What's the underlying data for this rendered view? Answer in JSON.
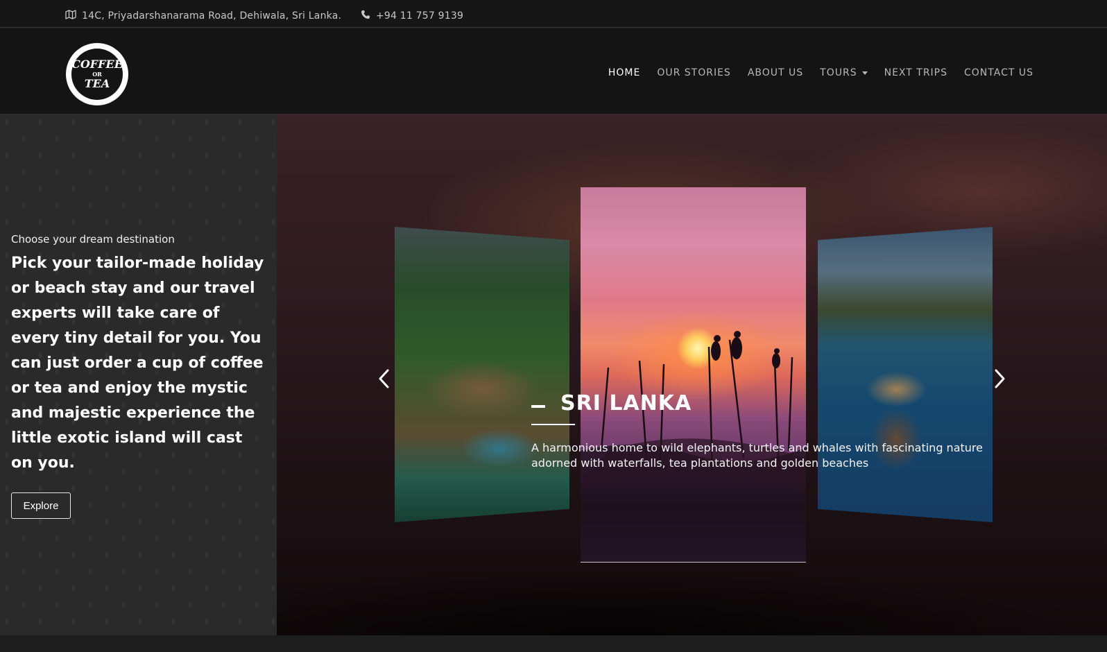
{
  "topbar": {
    "address": "14C, Priyadarshanarama Road, Dehiwala, Sri Lanka.",
    "address_icon": "map-icon",
    "phone": "+94 11 757 9139",
    "phone_icon": "phone-icon"
  },
  "logo": {
    "line1": "COFFEE",
    "line2": "OR",
    "line3": "TEA"
  },
  "nav": {
    "items": [
      {
        "label": "HOME",
        "active": true
      },
      {
        "label": "OUR STORIES"
      },
      {
        "label": "ABOUT US"
      },
      {
        "label": "TOURS",
        "has_dropdown": true
      },
      {
        "label": "NEXT TRIPS"
      },
      {
        "label": "CONTACT US"
      }
    ]
  },
  "intro": {
    "kicker": "Choose your dream destination",
    "headline": "Pick your tailor-made holiday or beach stay and our travel experts will take care of every tiny detail for you. You can just order a cup of coffee or tea and enjoy the mystic and majestic experience the little exotic island will cast on you.",
    "button_label": "Explore"
  },
  "carousel": {
    "slide_title": "SRI LANKA",
    "slide_description": "A harmonious home to wild elephants, turtles and whales with fascinating nature adorned with waterfalls, tea plantations and golden beaches",
    "prev_icon": "chevron-left-icon",
    "next_icon": "chevron-right-icon"
  },
  "colors": {
    "topbar_bg": "#161616",
    "header_bg": "#141414",
    "left_panel_bg": "#2a2a2a",
    "nav_active": "#ffffff",
    "nav_inactive": "#b8b8b8"
  }
}
